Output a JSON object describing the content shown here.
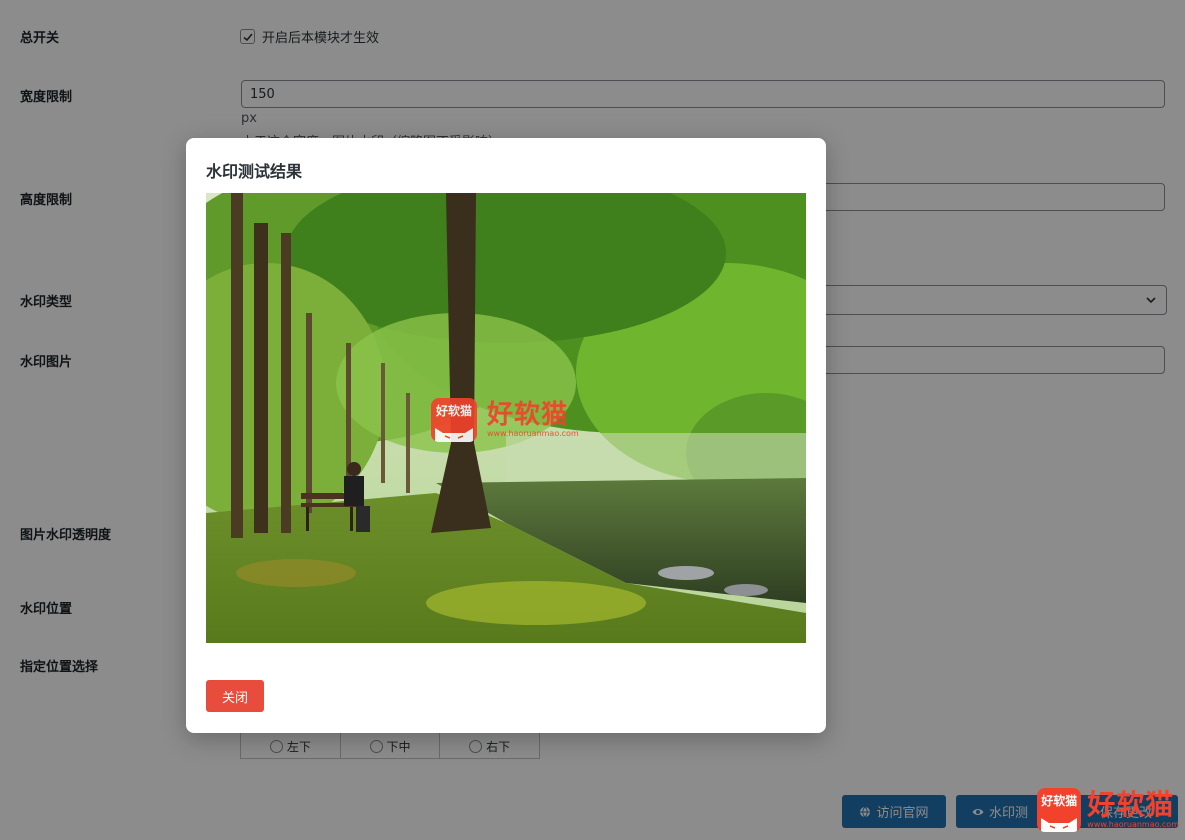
{
  "settings": {
    "master_switch": {
      "label": "总开关",
      "checkbox_text": "开启后本模块才生效",
      "checked": true
    },
    "width_limit": {
      "label": "宽度限制",
      "value": "150",
      "unit": "px",
      "hint_partial": "小于这个宽度，图片水印（缩略图不受影响）"
    },
    "height_limit": {
      "label": "高度限制"
    },
    "watermark_type": {
      "label": "水印类型"
    },
    "watermark_image": {
      "label": "水印图片"
    },
    "image_opacity": {
      "label": "图片水印透明度"
    },
    "watermark_position": {
      "label": "水印位置"
    },
    "position_select": {
      "label": "指定位置选择",
      "options_bottom_row": [
        "左下",
        "下中",
        "右下"
      ]
    }
  },
  "actions": {
    "visit_site": "访问官网",
    "watermark_test": "水印测",
    "save_partial": "保存更改"
  },
  "modal": {
    "title": "水印测试结果",
    "close_label": "关闭",
    "watermark_text": "好软猫",
    "watermark_square_text": "好软猫",
    "watermark_url": "www.haoruanmao.com"
  },
  "brand": {
    "square_text": "好软猫",
    "name": "好软猫",
    "url": "www.haoruanmao.com"
  },
  "colors": {
    "primary": "#2271b1",
    "danger": "#e74c3c",
    "brand_red": "#f2412c"
  }
}
